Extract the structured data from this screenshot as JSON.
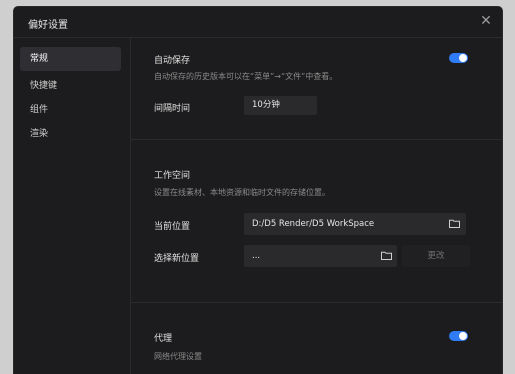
{
  "dialog": {
    "title": "偏好设置"
  },
  "sidebar": {
    "items": [
      {
        "label": "常规"
      },
      {
        "label": "快捷键"
      },
      {
        "label": "组件"
      },
      {
        "label": "渲染"
      }
    ]
  },
  "autosave": {
    "title": "自动保存",
    "description": "自动保存的历史版本可以在“菜单”→“文件”中查看。",
    "enabled": true,
    "interval_label": "间隔时间",
    "interval_value": "10分钟"
  },
  "workspace": {
    "title": "工作空间",
    "description": "设置在线素材、本地资源和临时文件的存储位置。",
    "current_label": "当前位置",
    "current_value": "D:/D5 Render/D5 WorkSpace",
    "new_label": "选择新位置",
    "new_value": "...",
    "change_button": "更改"
  },
  "proxy": {
    "title": "代理",
    "description": "网络代理设置",
    "enabled": true
  },
  "colors": {
    "accent": "#2f7cf6",
    "panel": "#1c1c1e",
    "field": "#2a2a2d"
  }
}
